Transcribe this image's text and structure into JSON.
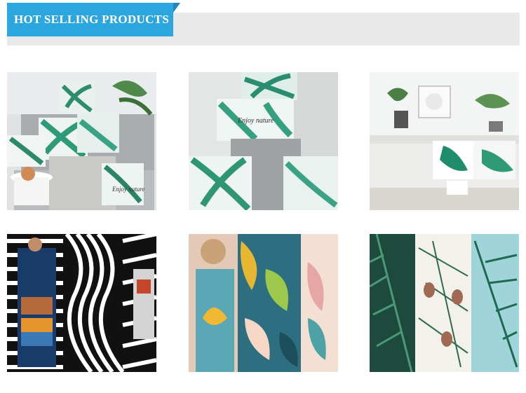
{
  "banner": {
    "title": "HOT SELLING PRODUCTS"
  },
  "products": [
    {
      "name": "pillow-sofa-tropical",
      "print_text": "Enjoy nature"
    },
    {
      "name": "pillow-stack-tropical",
      "print_text": "Enjoy nature"
    },
    {
      "name": "living-room-monstera"
    },
    {
      "name": "fabric-op-art-stripes"
    },
    {
      "name": "fabric-abstract-leaves"
    },
    {
      "name": "fabric-fern-pinecone"
    }
  ],
  "colors": {
    "accent": "#2ba6de",
    "banner_bg": "#e9e9e9"
  }
}
